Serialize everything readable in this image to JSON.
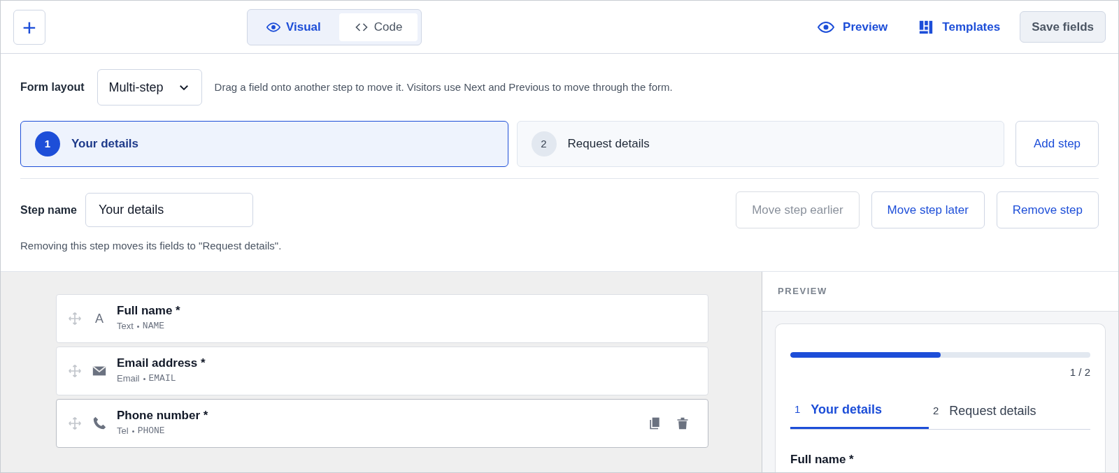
{
  "toolbar": {
    "add_label": "+",
    "view_tabs": [
      {
        "label": "Visual",
        "kind": "eye",
        "selected": true
      },
      {
        "label": "Code",
        "kind": "code",
        "selected": false
      }
    ],
    "links": [
      {
        "label": "Preview",
        "kind": "eye"
      },
      {
        "label": "Templates",
        "kind": "templates"
      }
    ],
    "save_button": "Save fields"
  },
  "form_layout": {
    "label": "Form layout",
    "value": "Multi-step",
    "hint": "Drag a field onto another step to move it. Visitors use Next and Previous to move through the form."
  },
  "steps": [
    {
      "number": "1",
      "name": "Your details",
      "selected": true
    },
    {
      "number": "2",
      "name": "Request details",
      "selected": false
    }
  ],
  "add_step": "Add step",
  "step_name": {
    "label": "Step name",
    "value": "Your details"
  },
  "step_actions": [
    {
      "label": "Move step earlier",
      "disabled": true
    },
    {
      "label": "Move step later",
      "disabled": false
    },
    {
      "label": "Remove step",
      "disabled": false
    }
  ],
  "remove_hint": "Removing this step moves its fields to \"Request details\".",
  "fields": [
    {
      "kind": "text",
      "glyph": "A",
      "label": "Full name *",
      "type": "Text",
      "key": "NAME",
      "actions_visible": false
    },
    {
      "kind": "email",
      "label": "Email address *",
      "type": "Email",
      "key": "EMAIL",
      "actions_visible": false
    },
    {
      "kind": "tel",
      "label": "Phone number *",
      "type": "Tel",
      "key": "PHONE",
      "actions_visible": true
    }
  ],
  "preview": {
    "heading": "PREVIEW",
    "progress": {
      "level": 0.5,
      "reading": "1 / 2"
    },
    "tabs": [
      {
        "number": "1",
        "label": "Your details",
        "selected": true
      },
      {
        "number": "2",
        "label": "Request details",
        "selected": false
      }
    ],
    "first_field_label": "Full name *"
  }
}
